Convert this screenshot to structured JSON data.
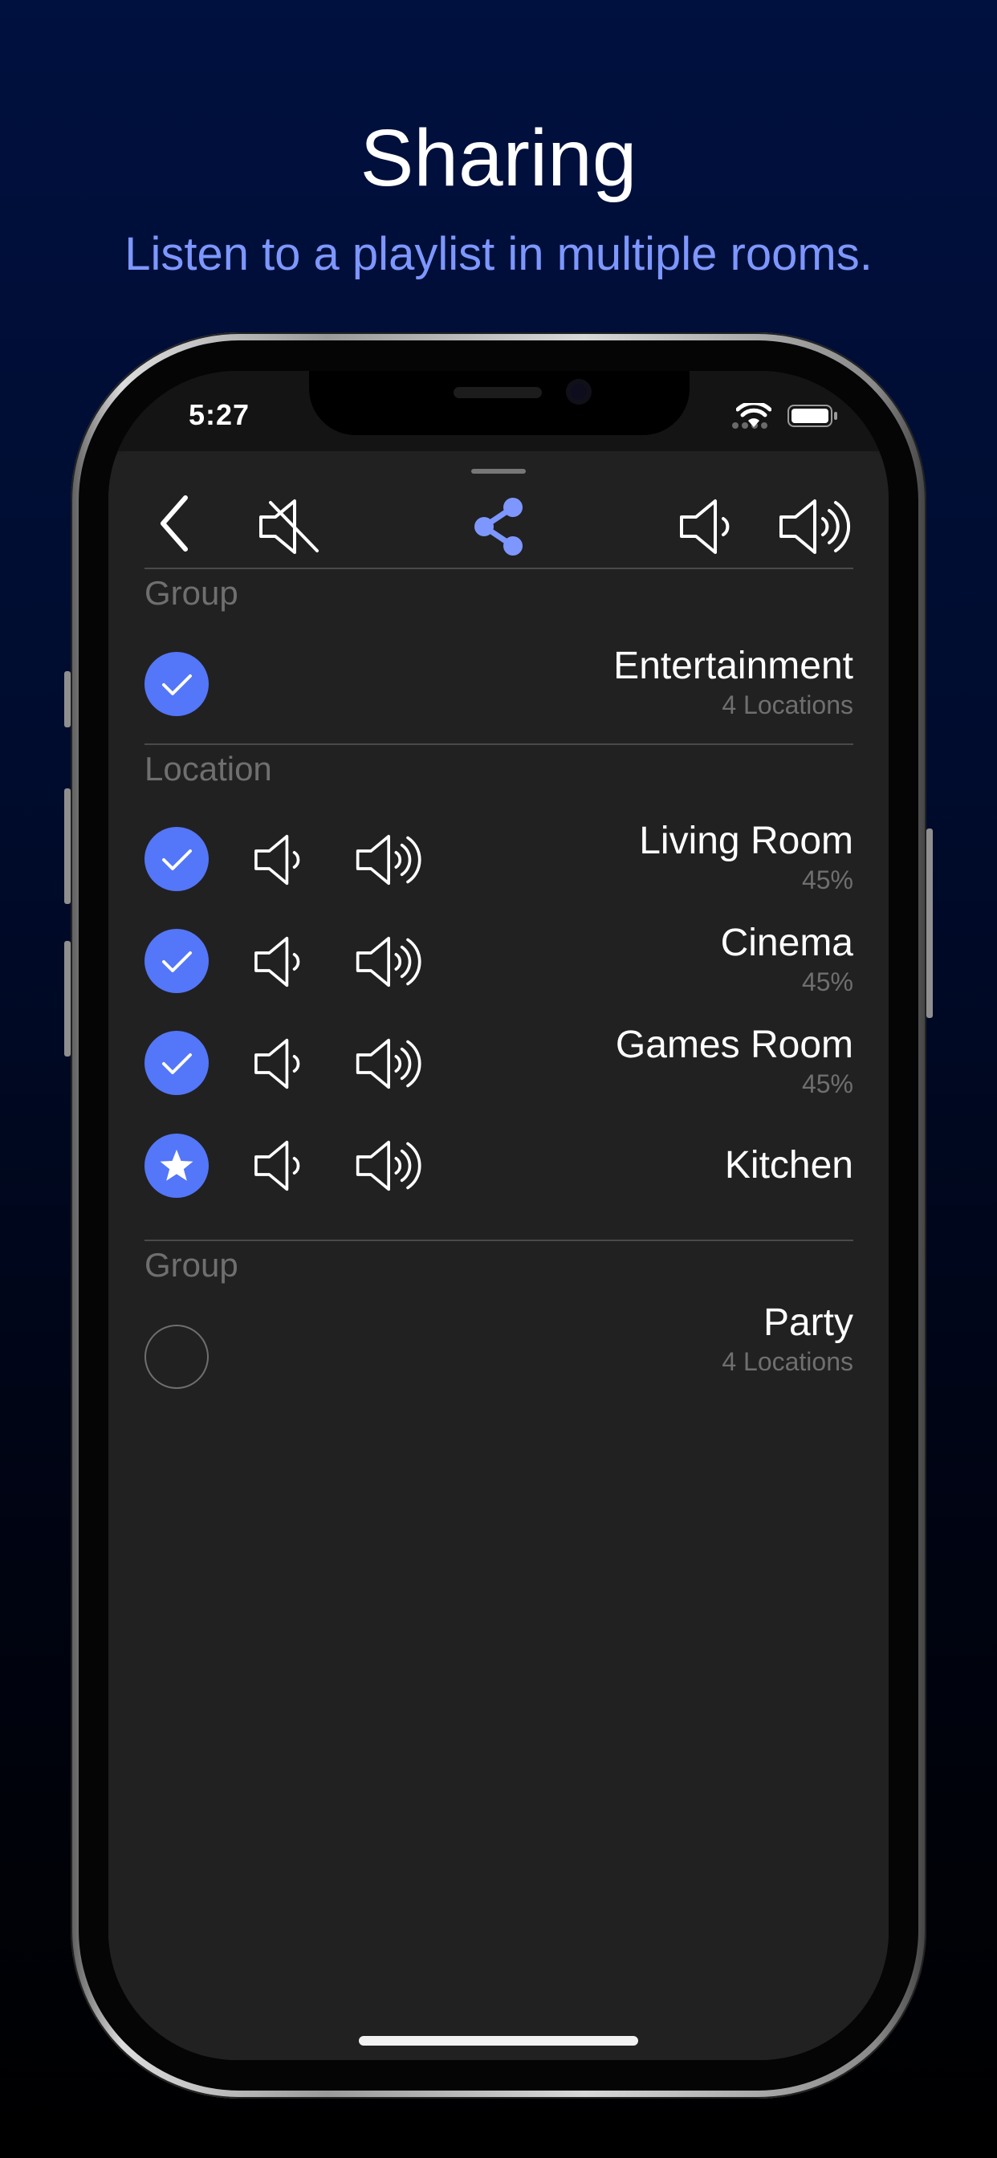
{
  "hero": {
    "title": "Sharing",
    "subtitle": "Listen to a playlist in multiple rooms."
  },
  "status_bar": {
    "time": "5:27",
    "icons": [
      "signal-dots-icon",
      "wifi-icon",
      "battery-icon"
    ]
  },
  "toolbar": {
    "icons": [
      "back-chevron-icon",
      "mute-icon",
      "share-icon",
      "volume-down-icon",
      "volume-up-icon"
    ],
    "accent_color": "#7d97ff"
  },
  "sections": [
    {
      "label": "Group",
      "items": [
        {
          "title": "Entertainment",
          "subtitle": "4 Locations",
          "state": "checked"
        }
      ]
    },
    {
      "label": "Location",
      "items": [
        {
          "title": "Living Room",
          "subtitle": "45%",
          "state": "checked"
        },
        {
          "title": "Cinema",
          "subtitle": "45%",
          "state": "checked"
        },
        {
          "title": "Games Room",
          "subtitle": "45%",
          "state": "checked"
        },
        {
          "title": "Kitchen",
          "subtitle": "",
          "state": "primary-star"
        }
      ]
    },
    {
      "label": "Group",
      "items": [
        {
          "title": "Party",
          "subtitle": "4 Locations",
          "state": "unchecked"
        }
      ]
    }
  ],
  "colors": {
    "check_blue": "#5476f8",
    "subtitle_blue": "#7d97ff",
    "sheet_bg": "#212121",
    "muted_text": "#6f6f6f"
  }
}
